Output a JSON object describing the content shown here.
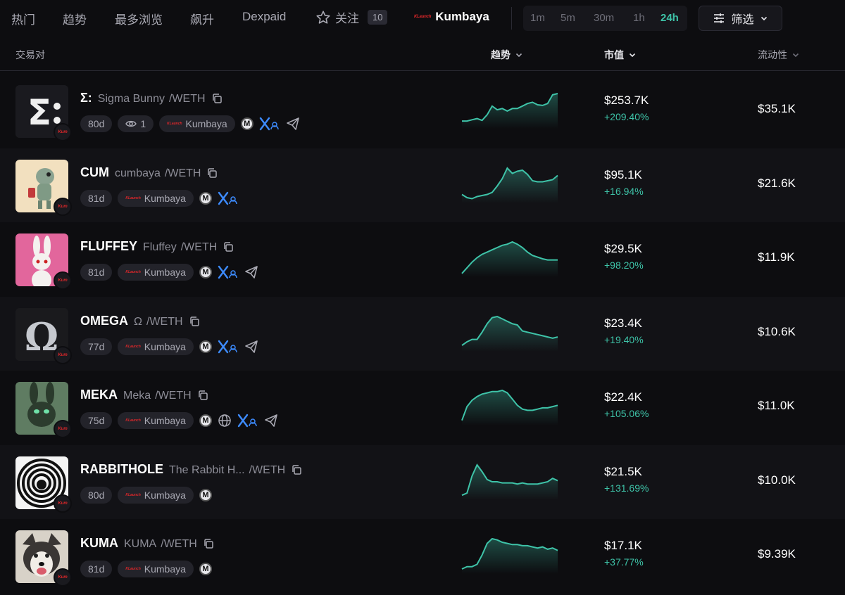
{
  "nav": {
    "tabs": [
      "热门",
      "趋势",
      "最多浏览",
      "飙升",
      "Dexpaid"
    ],
    "follow_label": "关注",
    "follow_count": "10",
    "launchpad_name": "Kumbaya",
    "timeframes": [
      "1m",
      "5m",
      "30m",
      "1h",
      "24h"
    ],
    "active_timeframe": "24h",
    "filter_label": "筛选"
  },
  "columns": {
    "pair": "交易对",
    "trend": "趋势",
    "mcap": "市值",
    "liquidity": "流动性"
  },
  "colors": {
    "accent": "#3ec3a8",
    "brand_red": "#e2272a",
    "twitter_blue": "#3d8bfd"
  },
  "rows": [
    {
      "symbol": "Σ:",
      "name": "Sigma Bunny",
      "pair": "/WETH",
      "age": "80d",
      "views": "1",
      "launchpad": "Kumbaya",
      "icons": [
        "m-icon",
        "x-icon",
        "telegram-icon"
      ],
      "mcap": "$253.7K",
      "change": "+209.40%",
      "liquidity": "$35.1K",
      "trend": [
        10,
        10,
        12,
        14,
        11,
        20,
        34,
        28,
        30,
        26,
        30,
        30,
        34,
        38,
        40,
        36,
        35,
        38,
        52,
        54
      ]
    },
    {
      "symbol": "CUM",
      "name": "cumbaya",
      "pair": "/WETH",
      "age": "81d",
      "launchpad": "Kumbaya",
      "icons": [
        "m-icon",
        "x-icon"
      ],
      "mcap": "$95.1K",
      "change": "+16.94%",
      "liquidity": "$21.6K",
      "trend": [
        14,
        8,
        6,
        10,
        12,
        14,
        18,
        30,
        44,
        64,
        54,
        58,
        60,
        52,
        40,
        38,
        38,
        40,
        42,
        50
      ]
    },
    {
      "symbol": "FLUFFEY",
      "name": "Fluffey",
      "pair": "/WETH",
      "age": "81d",
      "launchpad": "Kumbaya",
      "icons": [
        "m-icon",
        "x-icon",
        "telegram-icon"
      ],
      "mcap": "$29.5K",
      "change": "+98.20%",
      "liquidity": "$11.9K",
      "trend": [
        4,
        14,
        24,
        32,
        38,
        42,
        46,
        50,
        54,
        56,
        60,
        56,
        50,
        42,
        36,
        33,
        30,
        28,
        28,
        28
      ]
    },
    {
      "symbol": "OMEGA",
      "name": "Ω",
      "pair": "/WETH",
      "age": "77d",
      "launchpad": "Kumbaya",
      "icons": [
        "m-icon",
        "x-icon",
        "telegram-icon"
      ],
      "mcap": "$23.4K",
      "change": "+19.40%",
      "liquidity": "$10.6K",
      "trend": [
        8,
        14,
        18,
        18,
        30,
        44,
        54,
        56,
        52,
        48,
        44,
        42,
        32,
        30,
        28,
        26,
        24,
        22,
        20,
        22
      ]
    },
    {
      "symbol": "MEKA",
      "name": "Meka",
      "pair": "/WETH",
      "age": "75d",
      "launchpad": "Kumbaya",
      "icons": [
        "m-icon",
        "globe-icon",
        "x-icon",
        "telegram-icon"
      ],
      "mcap": "$22.4K",
      "change": "+105.06%",
      "liquidity": "$11.0K",
      "trend": [
        6,
        28,
        38,
        44,
        48,
        50,
        52,
        52,
        54,
        50,
        40,
        30,
        24,
        22,
        22,
        24,
        26,
        26,
        28,
        30
      ]
    },
    {
      "symbol": "RABBITHOLE",
      "name": "The Rabbit H...",
      "pair": "/WETH",
      "age": "80d",
      "launchpad": "Kumbaya",
      "icons": [
        "m-icon"
      ],
      "mcap": "$21.5K",
      "change": "+131.69%",
      "liquidity": "$10.0K",
      "trend": [
        6,
        10,
        40,
        60,
        48,
        34,
        30,
        30,
        28,
        28,
        28,
        26,
        28,
        26,
        26,
        26,
        28,
        30,
        36,
        32
      ]
    },
    {
      "symbol": "KUMA",
      "name": "KUMA",
      "pair": "/WETH",
      "age": "81d",
      "launchpad": "Kumbaya",
      "icons": [
        "m-icon"
      ],
      "mcap": "$17.1K",
      "change": "+37.77%",
      "liquidity": "$9.39K",
      "trend": [
        6,
        10,
        10,
        14,
        30,
        50,
        58,
        56,
        52,
        50,
        48,
        48,
        46,
        46,
        44,
        42,
        44,
        40,
        42,
        38
      ]
    }
  ]
}
